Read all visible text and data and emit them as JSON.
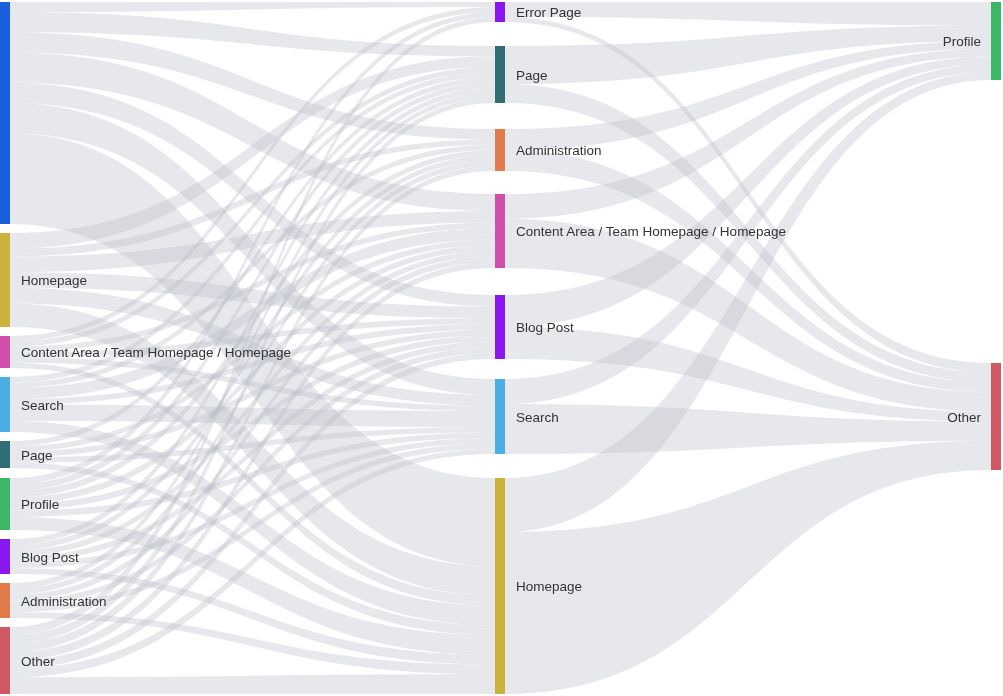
{
  "sankey": {
    "columns": [
      {
        "nodes": [
          {
            "color": "#1a5fdc"
          },
          {
            "label": "Homepage",
            "color": "#cbb23c"
          },
          {
            "label": "Content Area / Team Homepage / Homepage",
            "color": "#d14fab"
          },
          {
            "label": "Search",
            "color": "#4aaee3"
          },
          {
            "label": "Page",
            "color": "#2f6e74"
          },
          {
            "label": "Profile",
            "color": "#3bb866"
          },
          {
            "label": "Blog Post",
            "color": "#8a17f0"
          },
          {
            "label": "Administration",
            "color": "#e07b4b"
          },
          {
            "label": "Other",
            "color": "#cf5a64"
          }
        ]
      },
      {
        "nodes": [
          {
            "label": "Error Page",
            "color": "#8a17f0"
          },
          {
            "label": "Page",
            "color": "#2f6e74"
          },
          {
            "label": "Administration",
            "color": "#e07b4b"
          },
          {
            "label": "Content Area / Team Homepage / Homepage",
            "color": "#d14fab"
          },
          {
            "label": "Blog Post",
            "color": "#8a17f0"
          },
          {
            "label": "Search",
            "color": "#4aaee3"
          },
          {
            "label": "Homepage",
            "color": "#cbb23c"
          }
        ]
      },
      {
        "nodes": [
          {
            "label": "Profile",
            "color": "#3bb866"
          },
          {
            "label": "Other",
            "color": "#cf5a64"
          }
        ]
      }
    ]
  }
}
